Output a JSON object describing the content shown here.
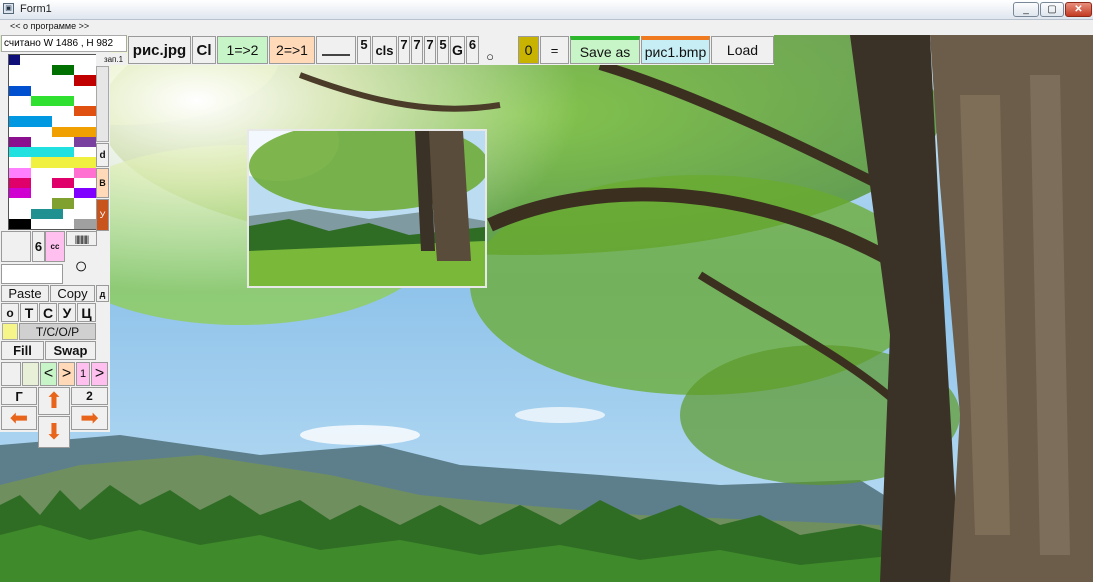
{
  "window": {
    "title": "Form1",
    "minimize": "_",
    "maximize": "▢",
    "close": "✕"
  },
  "menu": {
    "about": "<< о программе >>"
  },
  "status": {
    "text": "считано W 1486 , H 982",
    "small_label": "зап.1"
  },
  "toolbar": {
    "image_file": "рис.jpg",
    "cl": "Cl",
    "one_to_two": "1=>2",
    "two_to_one": "2=>1",
    "five": "5",
    "cls": "cls",
    "d1": "7",
    "d2": "7",
    "d3": "7",
    "d4": "5",
    "g": "G",
    "six": "6",
    "zero": "0",
    "equals": "=",
    "save_as": "Save as",
    "bmp_file": "рис1.bmp",
    "load": "Load"
  },
  "side": {
    "tab_d": "d",
    "tab_b": "B",
    "tab_u": "У",
    "six": "6",
    "cc": "cc",
    "paste": "Paste",
    "copy": "Copy",
    "small_d": "д",
    "o": "о",
    "t": "Т",
    "s": "С",
    "u": "У",
    "ts": "Ц",
    "tsop": "Т/С/О/Р",
    "fill": "Fill",
    "swap": "Swap",
    "left_arrow": "<",
    "right_arrow": ">",
    "one": "1",
    "right_arrow2": ">",
    "g": "Г",
    "two": "2"
  },
  "colors": {
    "green_accent": "#c8f5c8",
    "peach_accent": "#ffd9b8",
    "pink_accent": "#ffc0f0",
    "olive_accent": "#c8b400",
    "orange_arrow": "#e8641a"
  },
  "icons": {
    "app": "form-icon",
    "circle": "circle-icon",
    "barcode": "barcode-icon",
    "up": "arrow-up-icon",
    "down": "arrow-down-icon",
    "left": "arrow-left-icon",
    "right": "arrow-right-icon"
  },
  "palette": [
    [
      "#0f0f7a",
      "#ffffff",
      "#ffffff",
      "#ffffff",
      "#ffffff",
      "#ffffff",
      "#ffffff",
      "#ffffff"
    ],
    [
      "#ffffff",
      "#ffffff",
      "#ffffff",
      "#ffffff",
      "#007000",
      "#007000",
      "#ffffff",
      "#ffffff"
    ],
    [
      "#ffffff",
      "#ffffff",
      "#ffffff",
      "#ffffff",
      "#ffffff",
      "#ffffff",
      "#c00000",
      "#c00000"
    ],
    [
      "#0050d0",
      "#0050d0",
      "#ffffff",
      "#ffffff",
      "#ffffff",
      "#ffffff",
      "#ffffff",
      "#ffffff"
    ],
    [
      "#ffffff",
      "#ffffff",
      "#30e030",
      "#30e030",
      "#30e030",
      "#30e030",
      "#ffffff",
      "#ffffff"
    ],
    [
      "#ffffff",
      "#ffffff",
      "#ffffff",
      "#ffffff",
      "#ffffff",
      "#ffffff",
      "#e05010",
      "#e05010"
    ],
    [
      "#0098e0",
      "#0098e0",
      "#0098e0",
      "#0098e0",
      "#ffffff",
      "#ffffff",
      "#ffffff",
      "#ffffff"
    ],
    [
      "#ffffff",
      "#ffffff",
      "#ffffff",
      "#ffffff",
      "#f0a000",
      "#f0a000",
      "#f0a000",
      "#f0a000"
    ],
    [
      "#8a1090",
      "#8a1090",
      "#ffffff",
      "#ffffff",
      "#ffffff",
      "#ffffff",
      "#7a40a0",
      "#7a40a0"
    ],
    [
      "#20e0e0",
      "#20e0e0",
      "#20e0e0",
      "#20e0e0",
      "#20e0e0",
      "#20e0e0",
      "#ffffff",
      "#ffffff"
    ],
    [
      "#ffffff",
      "#ffffff",
      "#f0f040",
      "#f0f040",
      "#f0f040",
      "#f0f040",
      "#f0f040",
      "#f0f040"
    ],
    [
      "#ff80ff",
      "#ff80ff",
      "#ffffff",
      "#ffffff",
      "#ffffff",
      "#ffffff",
      "#ff70d0",
      "#ff70d0"
    ],
    [
      "#e0006a",
      "#e0006a",
      "#ffffff",
      "#ffffff",
      "#e0006a",
      "#e0006a",
      "#ffffff",
      "#ffffff"
    ],
    [
      "#d000d0",
      "#d000d0",
      "#ffffff",
      "#ffffff",
      "#ffffff",
      "#ffffff",
      "#8000ff",
      "#8000ff"
    ],
    [
      "#ffffff",
      "#ffffff",
      "#ffffff",
      "#ffffff",
      "#80a030",
      "#80a030",
      "#ffffff",
      "#ffffff"
    ],
    [
      "#ffffff",
      "#ffffff",
      "#209090",
      "#209090",
      "#209090",
      "#ffffff",
      "#ffffff",
      "#ffffff"
    ],
    [
      "#000000",
      "#000000",
      "#ffffff",
      "#ffffff",
      "#ffffff",
      "#ffffff",
      "#a0a0a0",
      "#a0a0a0"
    ]
  ]
}
